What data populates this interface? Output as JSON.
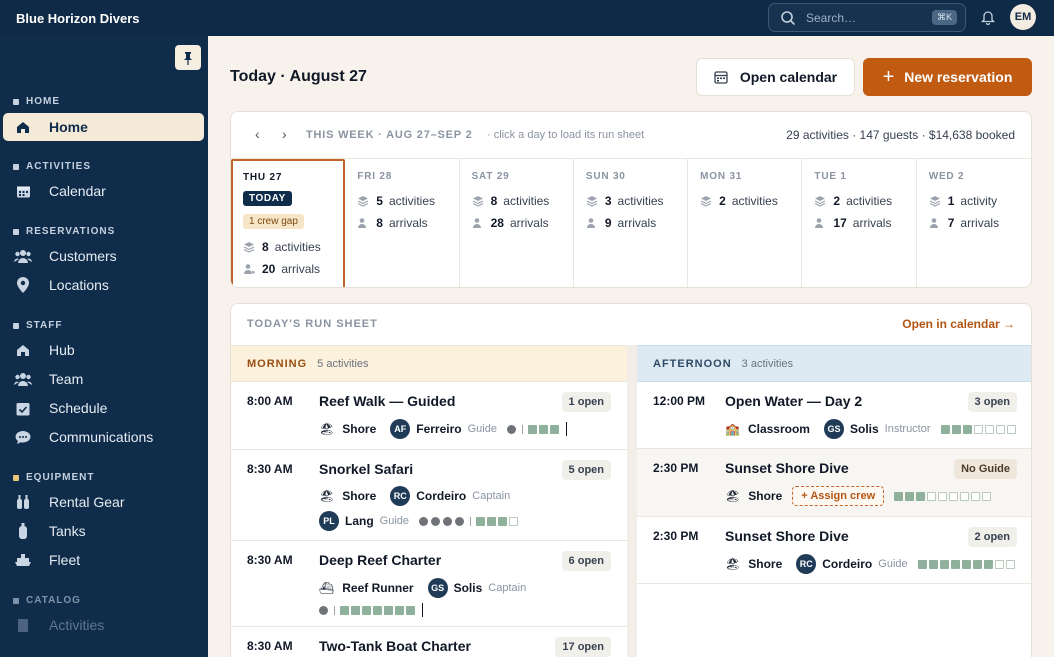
{
  "app": {
    "brand": "Blue Horizon Divers"
  },
  "topbar": {
    "search_placeholder": "Search…",
    "shortcut": "⌘K",
    "user_initials": "EM"
  },
  "sidebar": {
    "sections": {
      "home": "HOME",
      "activities": "ACTIVITIES",
      "reservations": "RESERVATIONS",
      "staff": "STAFF",
      "equipment": "EQUIPMENT",
      "catalog": "CATALOG"
    },
    "items": {
      "home": "Home",
      "calendar": "Calendar",
      "customers": "Customers",
      "locations": "Locations",
      "hub": "Hub",
      "team": "Team",
      "schedule": "Schedule",
      "communications": "Communications",
      "rental_gear": "Rental Gear",
      "tanks": "Tanks",
      "fleet": "Fleet",
      "activities": "Activities"
    }
  },
  "header": {
    "title": "Today · August 27",
    "open_calendar": "Open calendar",
    "new_reservation": "New reservation"
  },
  "week": {
    "prev": "‹",
    "next": "›",
    "label": "THIS WEEK · AUG 27–SEP 2",
    "hint": "click a day to load its run sheet",
    "summary": "29 activities · 147 guests · $14,638 booked",
    "today_badge": "TODAY",
    "crew_gap": "1 crew gap",
    "days": [
      {
        "name": "THU 27",
        "activities": "8",
        "activities_label": "activities",
        "arrivals": "20",
        "arrivals_label": "arrivals"
      },
      {
        "name": "FRI 28",
        "activities": "5",
        "activities_label": "activities",
        "arrivals": "8",
        "arrivals_label": "arrivals"
      },
      {
        "name": "SAT 29",
        "activities": "8",
        "activities_label": "activities",
        "arrivals": "28",
        "arrivals_label": "arrivals"
      },
      {
        "name": "SUN 30",
        "activities": "3",
        "activities_label": "activities",
        "arrivals": "9",
        "arrivals_label": "arrivals"
      },
      {
        "name": "MON 31",
        "activities": "2",
        "activities_label": "activities"
      },
      {
        "name": "TUE 1",
        "activities": "2",
        "activities_label": "activities",
        "arrivals": "17",
        "arrivals_label": "arrivals"
      },
      {
        "name": "WED 2",
        "activities": "1",
        "activities_label": "activity",
        "arrivals": "7",
        "arrivals_label": "arrivals"
      }
    ]
  },
  "run": {
    "title": "TODAY'S RUN SHEET",
    "open_link": "Open in calendar →",
    "morning": {
      "label": "MORNING",
      "count": "5 activities"
    },
    "afternoon": {
      "label": "AFTERNOON",
      "count": "3 activities"
    },
    "am": [
      {
        "time": "8:00 AM",
        "name": "Reef Walk — Guided",
        "status": "1 open",
        "location": "Shore",
        "p1": {
          "initials": "AF",
          "name": "Ferreiro",
          "role": "Guide"
        }
      },
      {
        "time": "8:30 AM",
        "name": "Snorkel Safari",
        "status": "5 open",
        "location": "Shore",
        "p1": {
          "initials": "RC",
          "name": "Cordeiro",
          "role": "Captain"
        },
        "p2": {
          "initials": "PL",
          "name": "Lang",
          "role": "Guide"
        }
      },
      {
        "time": "8:30 AM",
        "name": "Deep Reef Charter",
        "status": "6 open",
        "location": "Reef Runner",
        "p1": {
          "initials": "GS",
          "name": "Solis",
          "role": "Captain"
        }
      },
      {
        "time": "8:30 AM",
        "name": "Two-Tank Boat Charter",
        "status": "17 open"
      }
    ],
    "pm": [
      {
        "time": "12:00 PM",
        "name": "Open Water — Day 2",
        "status": "3 open",
        "location": "Classroom",
        "p1": {
          "initials": "GS",
          "name": "Solis",
          "role": "Instructor"
        }
      },
      {
        "time": "2:30 PM",
        "name": "Sunset Shore Dive",
        "status": "No Guide",
        "location": "Shore",
        "assign": "+ Assign crew"
      },
      {
        "time": "2:30 PM",
        "name": "Sunset Shore Dive",
        "status": "2 open",
        "location": "Shore",
        "p1": {
          "initials": "RC",
          "name": "Cordeiro",
          "role": "Guide"
        }
      }
    ]
  }
}
